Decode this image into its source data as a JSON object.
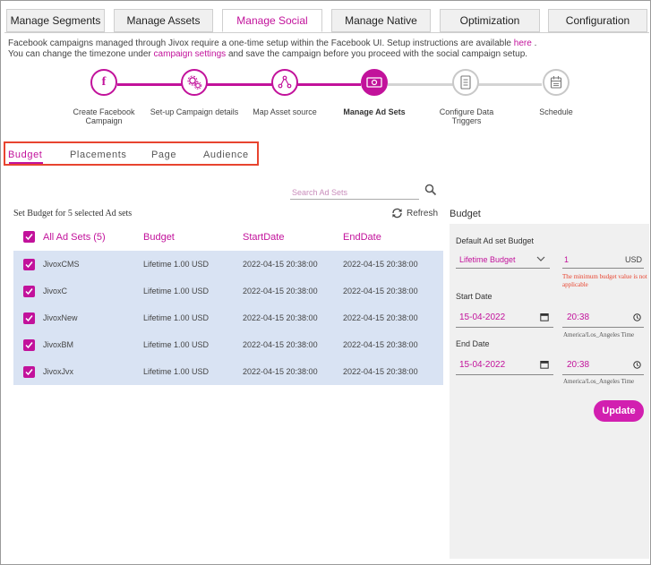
{
  "top_tabs": [
    "Manage Segments",
    "Manage Assets",
    "Manage Social",
    "Manage Native",
    "Optimization",
    "Configuration"
  ],
  "info": {
    "line1_text": "Facebook campaigns managed through Jivox require a one-time setup within the Facebook UI. Setup instructions are available",
    "line1_link": "here",
    "line1_end": ".",
    "line2_text": "You can change the timezone under",
    "line2_link": "campaign settings",
    "line2_end": "and save the campaign before you proceed with the social campaign setup."
  },
  "steps": [
    {
      "label": "Create Facebook Campaign",
      "icon": "facebook-icon",
      "state": "done"
    },
    {
      "label": "Set-up Campaign details",
      "icon": "gears-icon",
      "state": "done"
    },
    {
      "label": "Map Asset source",
      "icon": "share-nodes-icon",
      "state": "done"
    },
    {
      "label": "Manage Ad Sets",
      "icon": "money-icon",
      "state": "current"
    },
    {
      "label": "Configure Data Triggers",
      "icon": "document-icon",
      "state": "todo"
    },
    {
      "label": "Schedule",
      "icon": "calendar-icon",
      "state": "todo"
    }
  ],
  "sub_tabs": [
    "Budget",
    "Placements",
    "Page",
    "Audience"
  ],
  "search": {
    "placeholder": "Search Ad Sets"
  },
  "table": {
    "caption": "Set Budget for 5 selected Ad sets",
    "refresh_label": "Refresh",
    "columns": [
      "All Ad Sets (5)",
      "Budget",
      "StartDate",
      "EndDate"
    ],
    "rows": [
      {
        "name": "JivoxCMS",
        "budget": "Lifetime 1.00 USD",
        "start": "2022-04-15 20:38:00",
        "end": "2022-04-15 20:38:00"
      },
      {
        "name": "JivoxC",
        "budget": "Lifetime 1.00 USD",
        "start": "2022-04-15 20:38:00",
        "end": "2022-04-15 20:38:00"
      },
      {
        "name": "JivoxNew",
        "budget": "Lifetime 1.00 USD",
        "start": "2022-04-15 20:38:00",
        "end": "2022-04-15 20:38:00"
      },
      {
        "name": "JivoxBM",
        "budget": "Lifetime 1.00 USD",
        "start": "2022-04-15 20:38:00",
        "end": "2022-04-15 20:38:00"
      },
      {
        "name": "JivoxJvx",
        "budget": "Lifetime 1.00 USD",
        "start": "2022-04-15 20:38:00",
        "end": "2022-04-15 20:38:00"
      }
    ]
  },
  "budget_panel": {
    "title": "Budget",
    "default_label": "Default Ad set Budget",
    "budget_type": "Lifetime Budget",
    "amount": "1",
    "currency": "USD",
    "error": "The minimum budget value is not applicable",
    "start_label": "Start Date",
    "start_date": "15-04-2022",
    "start_time": "20:38",
    "end_label": "End Date",
    "end_date": "15-04-2022",
    "end_time": "20:38",
    "timezone": "America/Los_Angeles Time",
    "update_label": "Update"
  },
  "colors": {
    "accent": "#c2129b",
    "row_bg": "#d9e3f3",
    "error": "#e8442f"
  }
}
